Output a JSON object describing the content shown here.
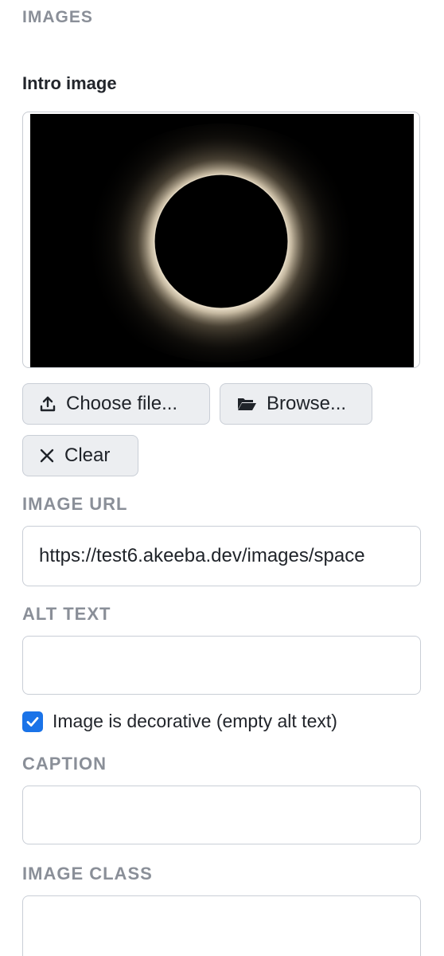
{
  "section": {
    "title": "IMAGES"
  },
  "intro_image": {
    "label": "Intro image",
    "choose_label": "Choose file...",
    "browse_label": "Browse...",
    "clear_label": "Clear"
  },
  "image_url": {
    "label": "IMAGE URL",
    "value": "https://test6.akeeba.dev/images/space"
  },
  "alt_text": {
    "label": "ALT TEXT",
    "value": "",
    "decorative_checked": true,
    "decorative_label": "Image is decorative (empty alt text)"
  },
  "caption": {
    "label": "CAPTION",
    "value": ""
  },
  "image_class": {
    "label": "IMAGE CLASS",
    "value": ""
  },
  "colors": {
    "accent": "#1a73e8",
    "label_gray": "#8a8f98"
  },
  "icons": [
    "upload-icon",
    "folder-open-icon",
    "close-icon",
    "check-icon"
  ]
}
